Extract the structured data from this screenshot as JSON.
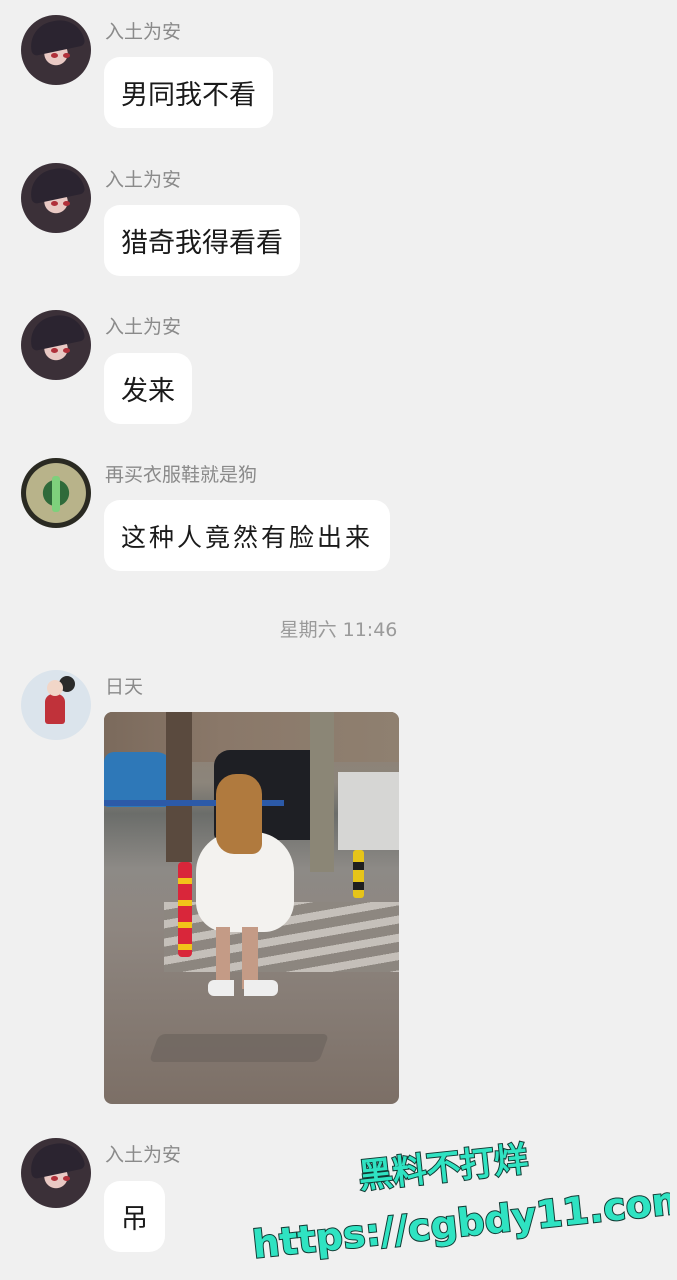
{
  "messages": [
    {
      "sender": "入土为安",
      "text": "男同我不看"
    },
    {
      "sender": "入土为安",
      "text": "猎奇我得看看"
    },
    {
      "sender": "入土为安",
      "text": "发来"
    },
    {
      "sender": "再买衣服鞋就是狗",
      "text": "这种人竟然有脸出来"
    },
    {
      "sender": "日天",
      "text": ""
    },
    {
      "sender": "入土为安",
      "text": "吊"
    }
  ],
  "timestamp": "星期六 11:46",
  "watermark": {
    "line1": "黑料不打烊",
    "line2": "https://cgbdy11.com"
  },
  "colors": {
    "background": "#f0f0f0",
    "bubble": "#ffffff",
    "name_text": "#8a8a8a",
    "watermark": "#2fe3c2"
  }
}
